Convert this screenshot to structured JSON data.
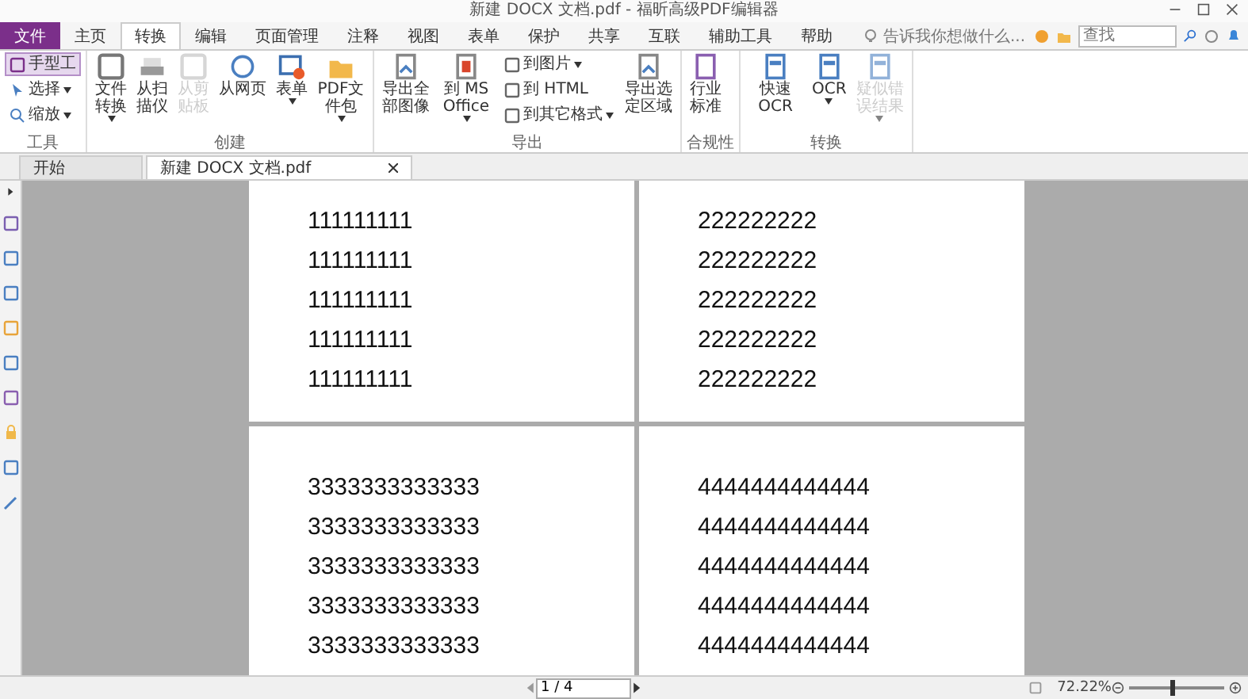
{
  "window": {
    "title": "新建 DOCX 文档.pdf - 福昕高级PDF编辑器"
  },
  "menu_tabs": [
    {
      "label": "文件",
      "kind": "file",
      "selected": false
    },
    {
      "label": "主页",
      "kind": "tab",
      "selected": false
    },
    {
      "label": "转换",
      "kind": "tab",
      "selected": true
    },
    {
      "label": "编辑",
      "kind": "tab",
      "selected": false
    },
    {
      "label": "页面管理",
      "kind": "tab",
      "selected": false
    },
    {
      "label": "注释",
      "kind": "tab",
      "selected": false
    },
    {
      "label": "视图",
      "kind": "tab",
      "selected": false
    },
    {
      "label": "表单",
      "kind": "tab",
      "selected": false
    },
    {
      "label": "保护",
      "kind": "tab",
      "selected": false
    },
    {
      "label": "共享",
      "kind": "tab",
      "selected": false
    },
    {
      "label": "互联",
      "kind": "tab",
      "selected": false
    },
    {
      "label": "辅助工具",
      "kind": "tab",
      "selected": false
    },
    {
      "label": "帮助",
      "kind": "tab",
      "selected": false
    }
  ],
  "tell_me": {
    "placeholder": "告诉我你想做什么..."
  },
  "search": {
    "placeholder": "查找"
  },
  "ribbon_groups": [
    {
      "label": "工具",
      "buttons": [
        {
          "label": "手型工",
          "kind": "small",
          "selected": true,
          "disabled": false,
          "dropdown": false
        },
        {
          "label": "选择",
          "kind": "small",
          "selected": false,
          "disabled": false,
          "dropdown": true
        },
        {
          "label": "缩放",
          "kind": "small",
          "selected": false,
          "disabled": false,
          "dropdown": true
        }
      ]
    },
    {
      "label": "创建",
      "buttons": [
        {
          "label": "文件转换",
          "kind": "large",
          "disabled": false,
          "dropdown": true
        },
        {
          "label": "从扫描仪",
          "kind": "large",
          "disabled": false,
          "dropdown": false
        },
        {
          "label": "从剪贴板",
          "kind": "large",
          "disabled": true,
          "dropdown": false
        },
        {
          "label": "从网页",
          "kind": "large",
          "disabled": false,
          "dropdown": false
        },
        {
          "label": "表单",
          "kind": "large",
          "disabled": false,
          "dropdown": true
        },
        {
          "label": "PDF文件包",
          "kind": "large",
          "disabled": false,
          "dropdown": true
        }
      ]
    },
    {
      "label": "导出",
      "buttons": [
        {
          "label": "导出全部图像",
          "kind": "large",
          "disabled": false,
          "dropdown": false
        },
        {
          "label": "到 MS Office",
          "kind": "large",
          "disabled": false,
          "dropdown": true
        },
        {
          "label": "到图片",
          "kind": "small",
          "disabled": false,
          "dropdown": true
        },
        {
          "label": "到 HTML",
          "kind": "small",
          "disabled": false,
          "dropdown": false
        },
        {
          "label": "到其它格式",
          "kind": "small",
          "disabled": false,
          "dropdown": true
        },
        {
          "label": "导出选定区域",
          "kind": "large",
          "disabled": false,
          "dropdown": false
        }
      ]
    },
    {
      "label": "合规性",
      "buttons": [
        {
          "label": "行业标准",
          "kind": "large",
          "disabled": false,
          "dropdown": false
        }
      ]
    },
    {
      "label": "转换",
      "buttons": [
        {
          "label": "快速 OCR",
          "kind": "large",
          "disabled": false,
          "dropdown": false
        },
        {
          "label": "OCR",
          "kind": "large",
          "disabled": false,
          "dropdown": true
        },
        {
          "label": "疑似错误结果",
          "kind": "large",
          "disabled": true,
          "dropdown": true
        }
      ]
    }
  ],
  "doc_tabs": [
    {
      "label": "开始",
      "selected": false,
      "closable": false
    },
    {
      "label": "新建 DOCX 文档.pdf",
      "selected": true,
      "closable": true
    }
  ],
  "pages": [
    {
      "lines": [
        "111111111",
        "111111111",
        "111111111",
        "111111111",
        "111111111"
      ]
    },
    {
      "lines": [
        "222222222",
        "222222222",
        "222222222",
        "222222222",
        "222222222"
      ]
    },
    {
      "lines": [
        "3333333333333",
        "3333333333333",
        "3333333333333",
        "3333333333333",
        "3333333333333"
      ]
    },
    {
      "lines": [
        "4444444444444",
        "4444444444444",
        "4444444444444",
        "4444444444444",
        "4444444444444"
      ]
    }
  ],
  "status_bar": {
    "page": "1 / 4",
    "zoom": "72.22%",
    "zoom_slider": {
      "level": 0.45
    }
  }
}
